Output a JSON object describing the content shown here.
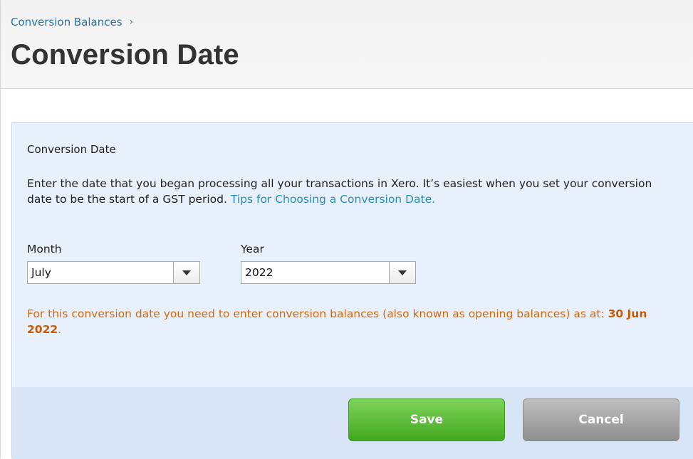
{
  "header": {
    "breadcrumb": "Conversion Balances",
    "title": "Conversion Date"
  },
  "panel": {
    "title": "Conversion Date",
    "description": "Enter the date that you began processing all your transactions in Xero. It’s easiest when you set your conversion date to be the start of a GST period.",
    "tips_link": "Tips for Choosing a Conversion Date.",
    "month_label": "Month",
    "month_value": "July",
    "year_label": "Year",
    "year_value": "2022",
    "note_text": "For this conversion date you need to enter conversion balances (also known as opening balances) as at:",
    "note_date": "30 Jun 2022",
    "note_period": "."
  },
  "footer": {
    "save_label": "Save",
    "cancel_label": "Cancel"
  },
  "icons": {
    "breadcrumb_separator": "chevron-right-icon",
    "dropdown": "triangle-down-icon"
  },
  "colors": {
    "link": "#2a72a8",
    "note": "#d4690a",
    "save": "#41a81f",
    "cancel": "#8f8f8f",
    "panel_bg": "#e8f0fc"
  }
}
